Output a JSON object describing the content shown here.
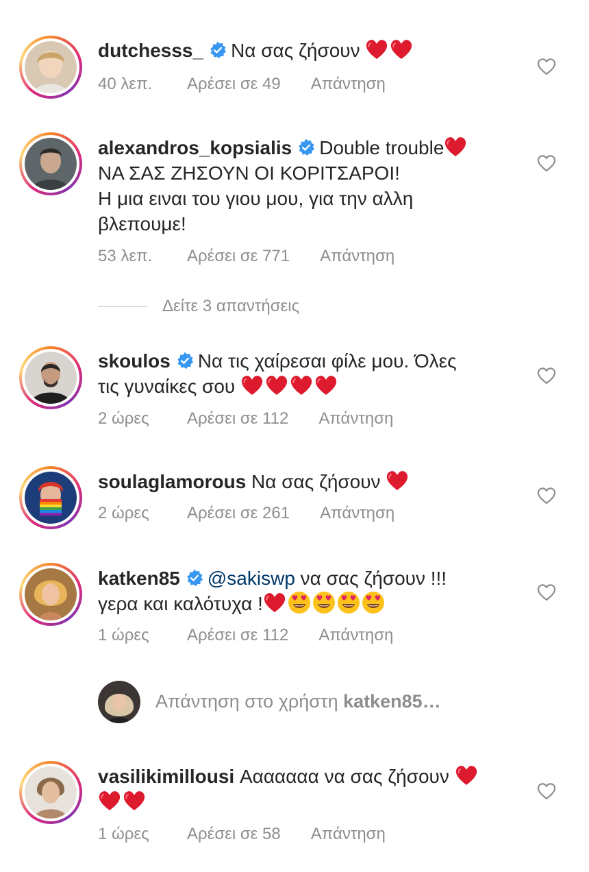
{
  "comments": [
    {
      "username": "dutchesss_",
      "verified": true,
      "text": "Να σας ζήσουν",
      "time": "40 λεπ.",
      "likes": "Αρέσει σε 49",
      "reply": "Απάντηση"
    },
    {
      "username": "alexandros_kopsialis",
      "verified": true,
      "text_line1": "Double trouble",
      "text_line2": "ΝΑ ΣΑΣ ΖΗΣΟΥΝ ΟΙ ΚΟΡΙΤΣΑΡΟΙ!",
      "text_line3": "Η μια ειναι του γιου μου, για την αλλη",
      "text_line4": "βλεπουμε!",
      "time": "53 λεπ.",
      "likes": "Αρέσει σε 771",
      "reply": "Απάντηση"
    },
    {
      "username": "skoulos",
      "verified": true,
      "text_line1": "Να τις χαίρεσαι φίλε μου. Όλες",
      "text_line2": "τις γυναίκες σου",
      "time": "2 ώρες",
      "likes": "Αρέσει σε 112",
      "reply": "Απάντηση"
    },
    {
      "username": "soulaglamorous",
      "verified": false,
      "text": "Να σας ζήσουν",
      "time": "2 ώρες",
      "likes": "Αρέσει σε 261",
      "reply": "Απάντηση"
    },
    {
      "username": "katken85",
      "verified": true,
      "mention": "@sakiswp",
      "text_line1": "να σας ζήσουν !!!",
      "text_line2": "γερα και καλότυχα !",
      "time": "1 ώρες",
      "likes": "Αρέσει σε 112",
      "reply": "Απάντηση"
    },
    {
      "username": "vasilikimillousi",
      "verified": false,
      "text": "Ααααααα να σας ζήσουν",
      "time": "1 ώρες",
      "likes": "Αρέσει σε 58",
      "reply": "Απάντηση"
    }
  ],
  "view_replies": "Δείτε 3 απαντήσεις",
  "reply_input": {
    "prefix": "Απάντηση στο χρήστη",
    "target": "katken85…"
  },
  "colors": {
    "text": "#262626",
    "muted": "#8e8e8e",
    "mention": "#00376b",
    "verified": "#3897f0",
    "heart": "#e0245e"
  },
  "icons": {
    "like": "heart-outline-icon",
    "verified": "verified-badge-icon",
    "emoji_heart": "red-heart-emoji",
    "emoji_face": "heart-eyes-emoji"
  }
}
